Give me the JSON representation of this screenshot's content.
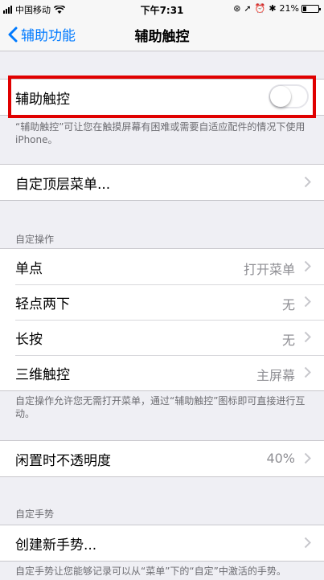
{
  "status_bar": {
    "carrier": "中国移动",
    "time": "下午7:31",
    "battery": "21%",
    "battery_level": 0.21
  },
  "nav": {
    "back_label": "辅助功能",
    "title": "辅助触控"
  },
  "assistive_touch": {
    "label": "辅助触控",
    "enabled": false,
    "footer": "“辅助触控”可让您在触摸屏幕有困难或需要自适应配件的情况下使用 iPhone。"
  },
  "top_menu": {
    "label": "自定顶层菜单..."
  },
  "custom_actions": {
    "header": "自定操作",
    "rows": [
      {
        "label": "单点",
        "value": "打开菜单"
      },
      {
        "label": "轻点两下",
        "value": "无"
      },
      {
        "label": "长按",
        "value": "无"
      },
      {
        "label": "三维触控",
        "value": "主屏幕"
      }
    ],
    "footer": "自定操作允许您无需打开菜单，通过“辅助触控”图标即可直接进行互动。"
  },
  "idle_opacity": {
    "label": "闲置时不透明度",
    "value": "40%"
  },
  "custom_gestures": {
    "header": "自定手势",
    "new_label": "创建新手势...",
    "footer": "自定手势让您能够记录可以从“菜单”下的“自定”中激活的手势。"
  },
  "colors": {
    "accent": "#007aff",
    "highlight": "#e00000",
    "background": "#efeff4"
  }
}
